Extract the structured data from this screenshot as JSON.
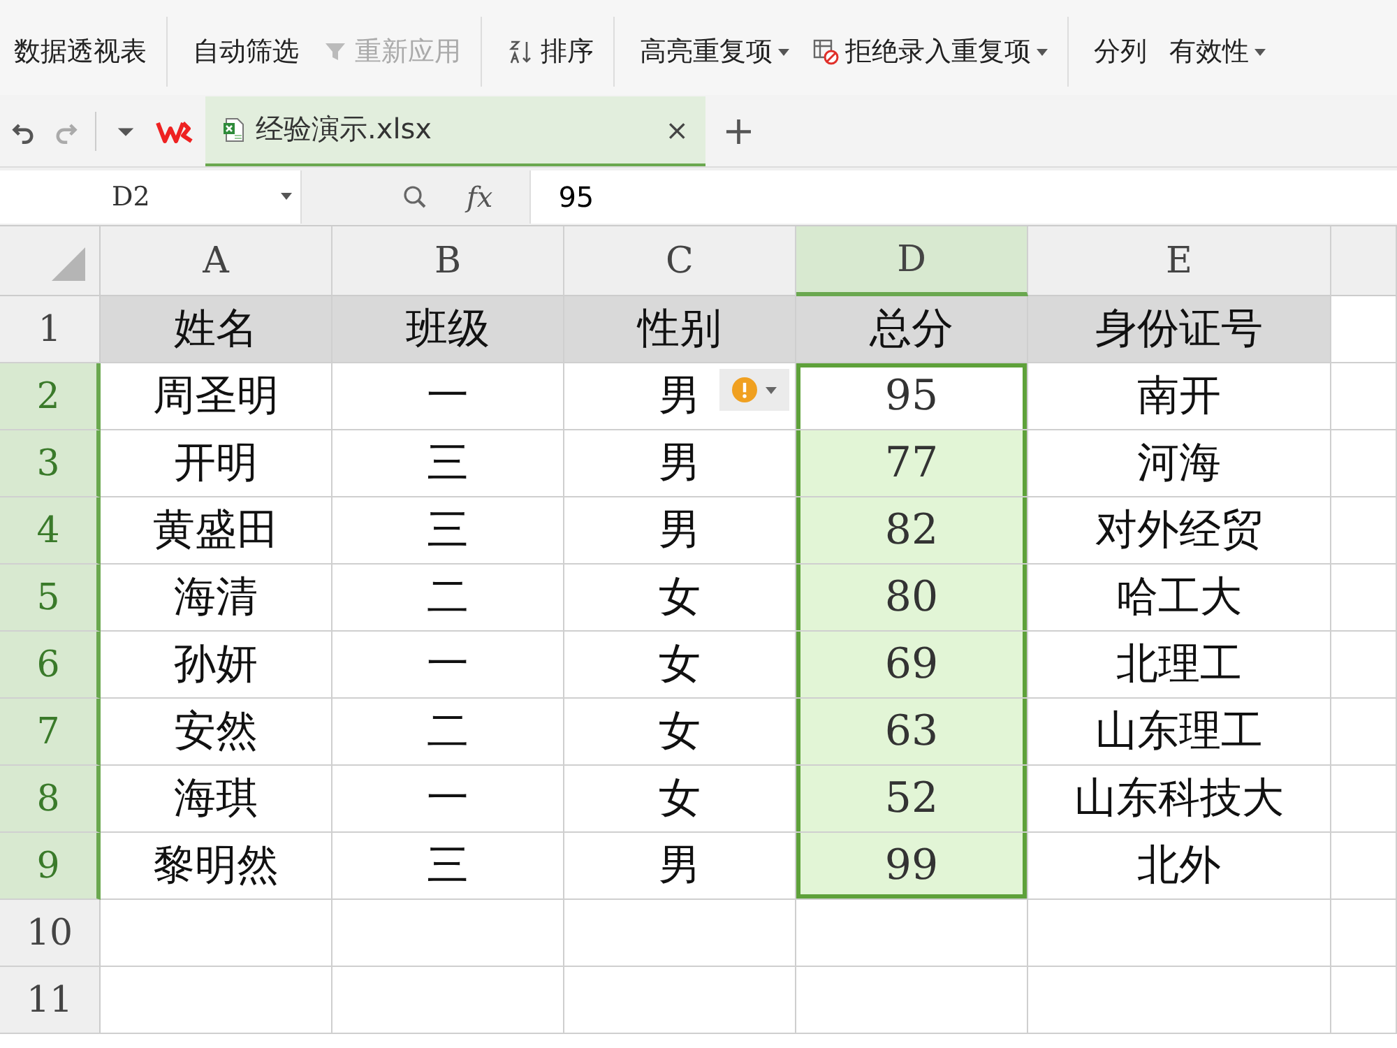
{
  "ribbon": [
    {
      "label": "数据透视表",
      "disabled": false,
      "dropdown": false,
      "kind": "plain",
      "divider_after": true
    },
    {
      "label": "自动筛选",
      "disabled": false,
      "dropdown": false,
      "kind": "plain",
      "divider_after": false
    },
    {
      "label": "重新应用",
      "disabled": true,
      "dropdown": false,
      "kind": "filter",
      "divider_after": true
    },
    {
      "label": "排序",
      "disabled": false,
      "dropdown": false,
      "kind": "sort",
      "divider_after": true
    },
    {
      "label": "高亮重复项",
      "disabled": false,
      "dropdown": true,
      "kind": "plain",
      "divider_after": false
    },
    {
      "label": "拒绝录入重复项",
      "disabled": false,
      "dropdown": true,
      "kind": "reject",
      "divider_after": true
    },
    {
      "label": "分列",
      "disabled": false,
      "dropdown": false,
      "kind": "plain",
      "divider_after": false
    },
    {
      "label": "有效性",
      "disabled": false,
      "dropdown": true,
      "kind": "plain",
      "divider_after": false
    }
  ],
  "tabs": [
    {
      "label": "经验演示.xlsx",
      "selected": true,
      "close": "×"
    }
  ],
  "new_tab": "+",
  "formula_bar": {
    "name_box": "D2",
    "fx": "fx",
    "value": "95"
  },
  "columns": [
    {
      "label": "A",
      "selected": false
    },
    {
      "label": "B",
      "selected": false
    },
    {
      "label": "C",
      "selected": false
    },
    {
      "label": "D",
      "selected": true
    },
    {
      "label": "E",
      "selected": false
    }
  ],
  "rows": [
    {
      "number": "1",
      "selected": false,
      "active": false,
      "shaded": true,
      "warning": false,
      "cells": [
        "姓名",
        "班级",
        "性别",
        "总分",
        "身份证号"
      ]
    },
    {
      "number": "2",
      "selected": true,
      "active": true,
      "shaded": false,
      "warning": true,
      "cells": [
        "周圣明",
        "一",
        "男",
        "95",
        "南开"
      ]
    },
    {
      "number": "3",
      "selected": true,
      "active": false,
      "shaded": false,
      "warning": false,
      "cells": [
        "开明",
        "三",
        "男",
        "77",
        "河海"
      ]
    },
    {
      "number": "4",
      "selected": true,
      "active": false,
      "shaded": false,
      "warning": false,
      "cells": [
        "黄盛田",
        "三",
        "男",
        "82",
        "对外经贸"
      ]
    },
    {
      "number": "5",
      "selected": true,
      "active": false,
      "shaded": false,
      "warning": false,
      "cells": [
        "海清",
        "二",
        "女",
        "80",
        "哈工大"
      ]
    },
    {
      "number": "6",
      "selected": true,
      "active": false,
      "shaded": false,
      "warning": false,
      "cells": [
        "孙妍",
        "一",
        "女",
        "69",
        "北理工"
      ]
    },
    {
      "number": "7",
      "selected": true,
      "active": false,
      "shaded": false,
      "warning": false,
      "cells": [
        "安然",
        "二",
        "女",
        "63",
        "山东理工"
      ]
    },
    {
      "number": "8",
      "selected": true,
      "active": false,
      "shaded": false,
      "warning": false,
      "cells": [
        "海琪",
        "一",
        "女",
        "52",
        "山东科技大"
      ]
    },
    {
      "number": "9",
      "selected": true,
      "active": false,
      "shaded": false,
      "warning": false,
      "cells": [
        "黎明然",
        "三",
        "男",
        "99",
        "北外"
      ]
    },
    {
      "number": "10",
      "selected": false,
      "active": false,
      "shaded": false,
      "warning": false
    },
    {
      "number": "11",
      "selected": false,
      "active": false,
      "shaded": false,
      "warning": false
    }
  ]
}
